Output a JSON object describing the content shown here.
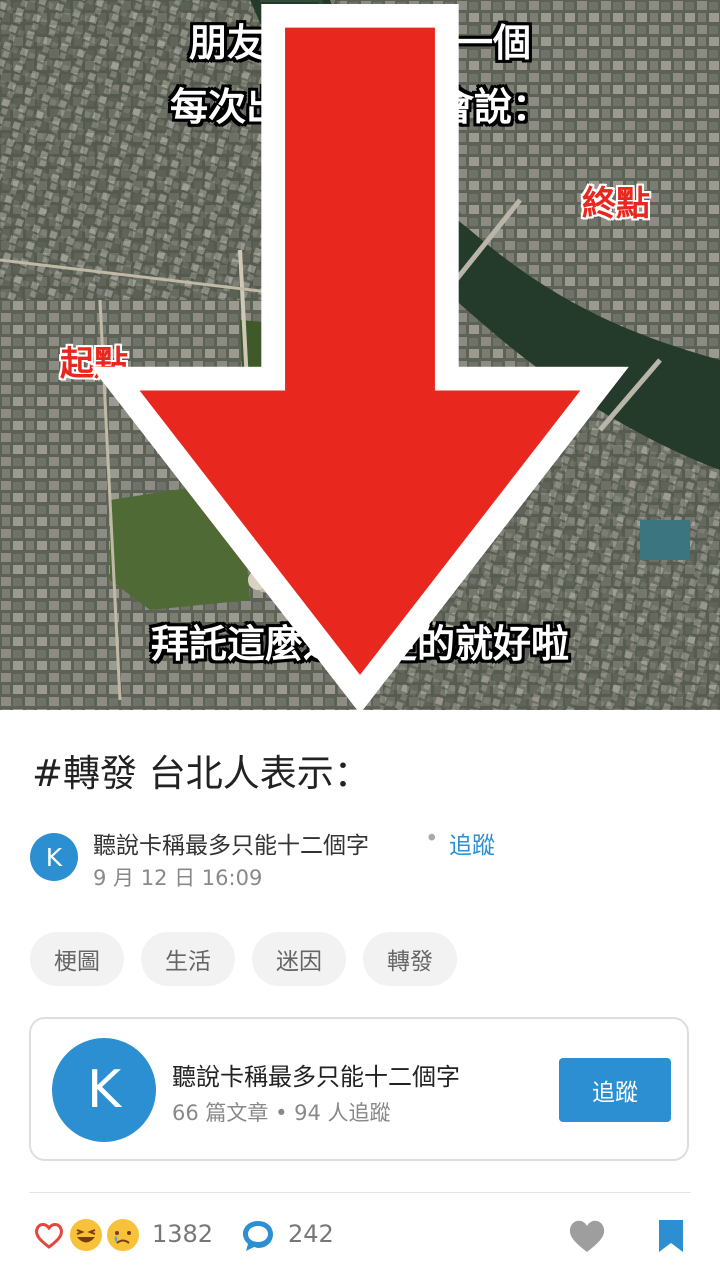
{
  "meme": {
    "line1": "朋友群裡面總有一個",
    "line2": "每次出去玩時都會說：",
    "line3": "拜託這麼近用走的就好啦",
    "start_label": "起點",
    "end_label": "終點",
    "arrow_color": "#e8281e"
  },
  "post": {
    "title": "#轉發 台北人表示：",
    "author": "聽說卡稱最多只能十二個字",
    "separator": "•",
    "follow": "追蹤",
    "date": "9 月 12 日 16:09",
    "avatar_letter": "K",
    "accent": "#2b8fd1"
  },
  "tags": [
    "梗圖",
    "生活",
    "迷因",
    "轉發"
  ],
  "author_card": {
    "avatar_letter": "K",
    "name": "聽說卡稱最多只能十二個字",
    "stats": "66 篇文章 • 94 人追蹤",
    "follow_button": "追蹤"
  },
  "footer": {
    "reaction_count": "1382",
    "comment_count": "242",
    "reaction_icons": [
      "heart-icon",
      "haha-icon",
      "sad-icon"
    ]
  }
}
